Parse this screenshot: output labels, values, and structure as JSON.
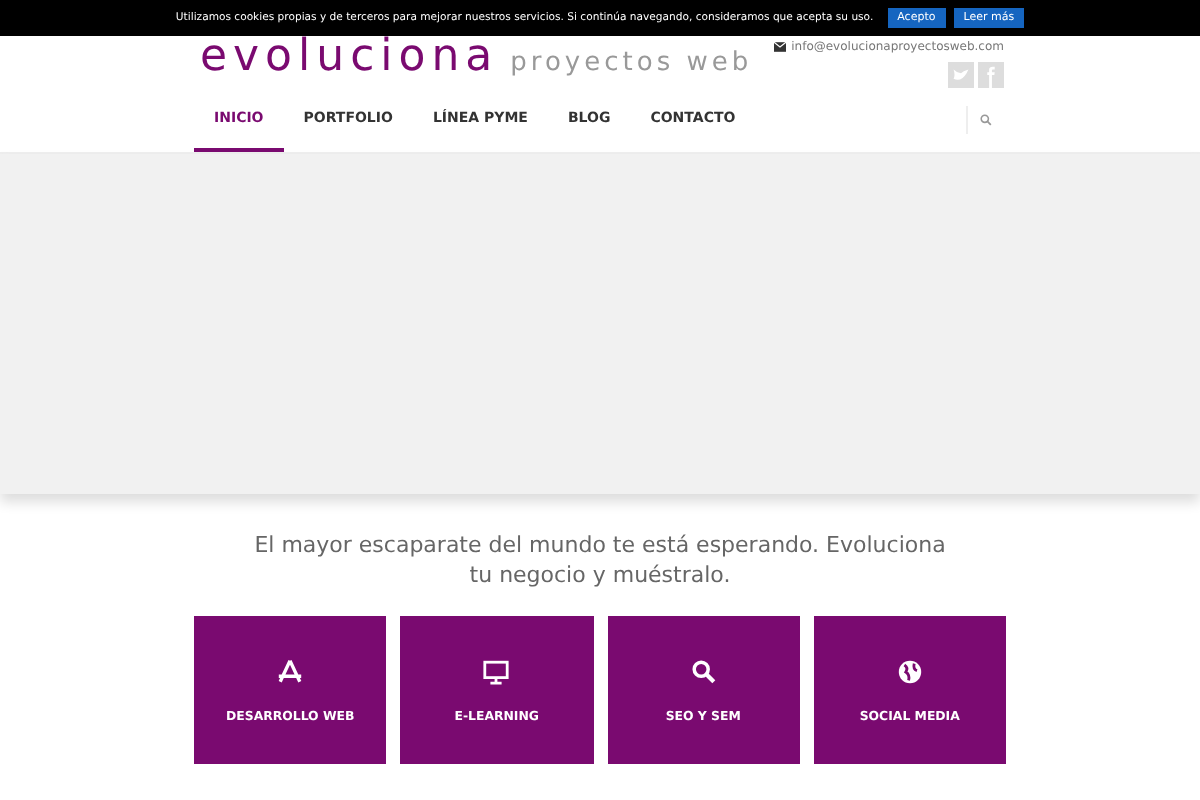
{
  "cookie_bar": {
    "text": "Utilizamos cookies propias y de terceros para mejorar nuestros servicios. Si continúa navegando, consideramos que acepta su uso.",
    "buttons": [
      "Acepto",
      "Leer más"
    ]
  },
  "header": {
    "logo_main": "evoluciona",
    "logo_sub": "proyectos web",
    "email": "info@evolucionaproyectosweb.com"
  },
  "nav": [
    {
      "label": "INICIO",
      "selected": true
    },
    {
      "label": "PORTFOLIO",
      "selected": false
    },
    {
      "label": "LÍNEA PYME",
      "selected": false
    },
    {
      "label": "BLOG",
      "selected": false
    },
    {
      "label": "CONTACTO",
      "selected": false
    }
  ],
  "tagline": "El mayor escaparate del mundo te está esperando. Evoluciona tu negocio y muéstralo.",
  "services": [
    {
      "label": "DESARROLLO WEB",
      "kind": "appstore"
    },
    {
      "label": "E-LEARNING",
      "kind": "monitor"
    },
    {
      "label": "SEO Y SEM",
      "kind": "search"
    },
    {
      "label": "SOCIAL MEDIA",
      "kind": "globe"
    }
  ]
}
